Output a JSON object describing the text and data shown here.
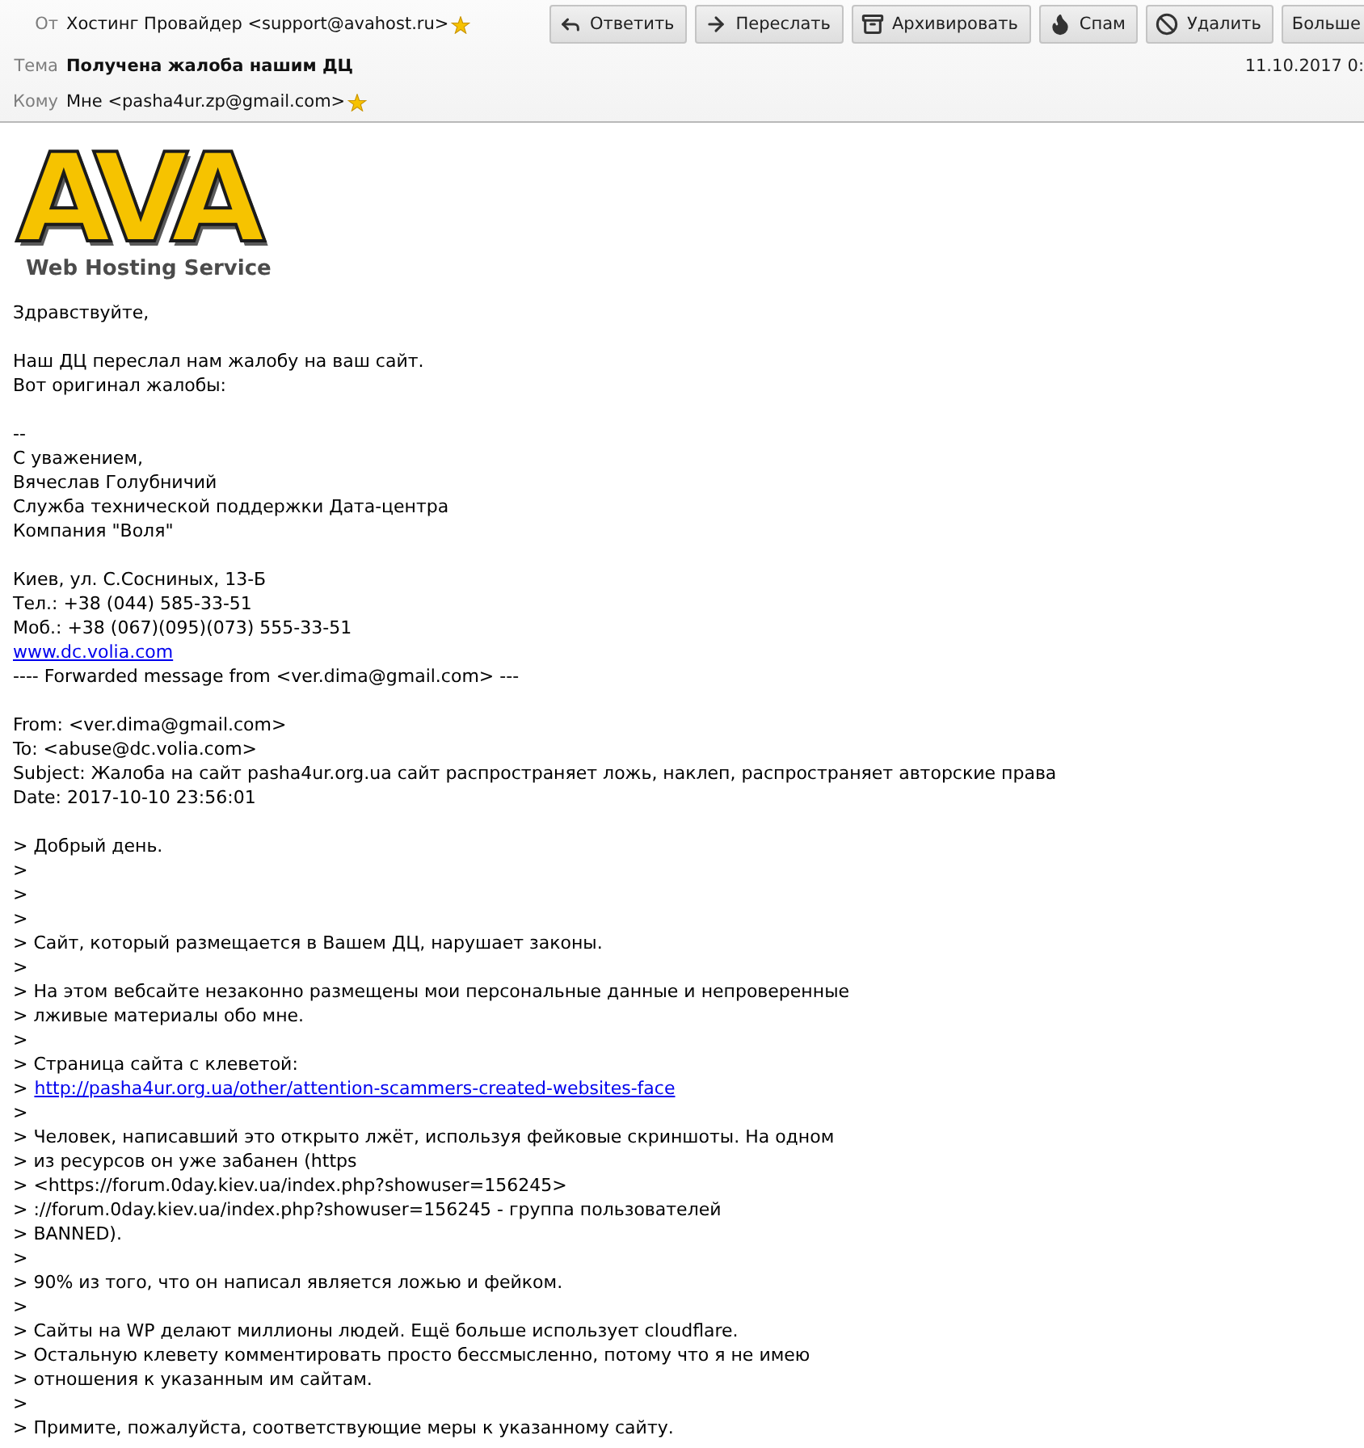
{
  "header": {
    "from": {
      "label": "От",
      "value": "Хостинг Провайдер <support@avahost.ru>"
    },
    "subject": {
      "label": "Тема",
      "value": "Получена жалоба нашим ДЦ"
    },
    "to": {
      "label": "Кому",
      "value": "Мне <pasha4ur.zp@gmail.com>"
    },
    "date": "11.10.2017 0:"
  },
  "toolbar": [
    {
      "kind": "reply",
      "label": "Ответить"
    },
    {
      "kind": "forward",
      "label": "Переслать"
    },
    {
      "kind": "archive",
      "label": "Архивировать"
    },
    {
      "kind": "junk",
      "label": "Спам"
    },
    {
      "kind": "delete",
      "label": "Удалить"
    },
    {
      "kind": "more",
      "label": "Больше"
    }
  ],
  "body": {
    "logo": {
      "wordmark": "AVA",
      "caption": "Web Hosting Service"
    },
    "blocks": [
      [
        {
          "kind": "text",
          "text": "Здравствуйте,"
        }
      ],
      [
        {
          "kind": "text",
          "text": "Наш ДЦ переслал нам жалобу на ваш сайт."
        },
        {
          "kind": "text",
          "text": "Вот оригинал жалобы:"
        }
      ],
      [
        {
          "kind": "text",
          "text": "--"
        },
        {
          "kind": "text",
          "text": "С уважением,"
        },
        {
          "kind": "text",
          "text": "Вячеслав Голубничий"
        },
        {
          "kind": "text",
          "text": "Служба технической поддержки Дата-центра"
        },
        {
          "kind": "text",
          "text": "Компания \"Воля\""
        }
      ],
      [
        {
          "kind": "text",
          "text": "Киев, ул. С.Сосниных, 13-Б"
        },
        {
          "kind": "text",
          "text": "Тел.: +38 (044) 585-33-51"
        },
        {
          "kind": "text",
          "text": "Моб.: +38 (067)(095)(073) 555-33-51"
        },
        {
          "kind": "link",
          "text": "www.dc.volia.com"
        },
        {
          "kind": "text",
          "text": "---- Forwarded message from <ver.dima@gmail.com> ---"
        }
      ],
      [
        {
          "kind": "text",
          "text": "From: <ver.dima@gmail.com>"
        },
        {
          "kind": "text",
          "text": "To: <abuse@dc.volia.com>"
        },
        {
          "kind": "text",
          "text": "Subject: Жалоба на сайт pasha4ur.org.ua сайт распространяет ложь, наклеп, распространяет авторские права"
        },
        {
          "kind": "text",
          "text": "Date: 2017-10-10 23:56:01"
        }
      ],
      [
        {
          "kind": "text",
          "text": "> Добрый день."
        },
        {
          "kind": "text",
          "text": ">"
        },
        {
          "kind": "text",
          "text": ">"
        },
        {
          "kind": "text",
          "text": ">"
        },
        {
          "kind": "text",
          "text": "> Сайт, который размещается в Вашем ДЦ, нарушает законы."
        },
        {
          "kind": "text",
          "text": ">"
        },
        {
          "kind": "text",
          "text": "> На этом вебсайте незаконно размещены мои персональные данные и непроверенные"
        },
        {
          "kind": "text",
          "text": "> лживые материалы обо мне."
        },
        {
          "kind": "text",
          "text": ">"
        },
        {
          "kind": "text",
          "text": "> Страница сайта с клеветой:"
        },
        {
          "kind": "link",
          "prefix": ">",
          "text": "http://pasha4ur.org.ua/other/attention-scammers-created-websites-face"
        },
        {
          "kind": "text",
          "text": ">"
        },
        {
          "kind": "text",
          "text": "> Человек, написавший это открыто лжёт, используя фейковые скриншоты. На одном"
        },
        {
          "kind": "text",
          "text": "> из ресурсов он уже забанен (https"
        },
        {
          "kind": "text",
          "text": "> <https://forum.0day.kiev.ua/index.php?showuser=156245>"
        },
        {
          "kind": "text",
          "text": "> ://forum.0day.kiev.ua/index.php?showuser=156245 - группа пользователей"
        },
        {
          "kind": "text",
          "text": "> BANNED)."
        },
        {
          "kind": "text",
          "text": ">"
        },
        {
          "kind": "text",
          "text": "> 90% из того, что он написал является ложью и фейком."
        },
        {
          "kind": "text",
          "text": ">"
        },
        {
          "kind": "text",
          "text": "> Сайты на WP делают миллионы людей. Ещё больше использует cloudflare."
        },
        {
          "kind": "text",
          "text": "> Остальную клевету комментировать просто бессмысленно, потому что я не имею"
        },
        {
          "kind": "text",
          "text": "> отношения к указанным им сайтам."
        },
        {
          "kind": "text",
          "text": ">"
        },
        {
          "kind": "text",
          "text": "> Примите, пожалуйста, соответствующие меры к указанному сайту."
        }
      ]
    ]
  }
}
